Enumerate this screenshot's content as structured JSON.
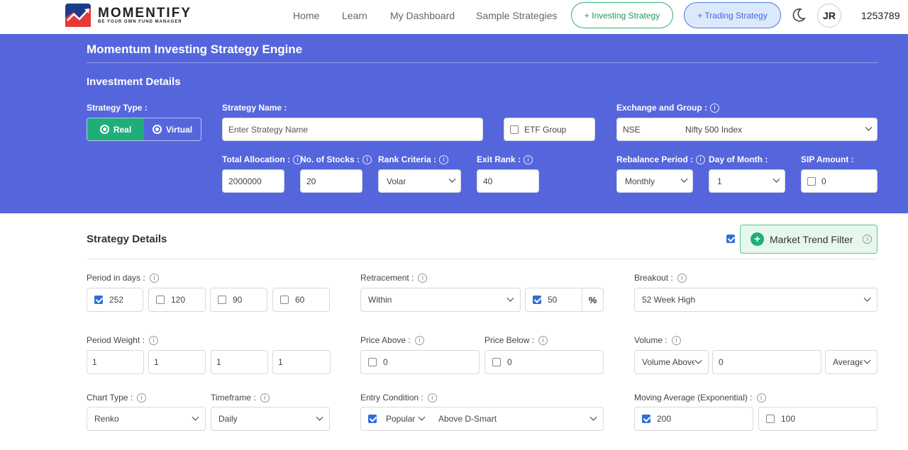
{
  "header": {
    "brand": "MOMENTIFY",
    "tagline": "BE YOUR OWN FUND MANAGER",
    "nav": [
      "Home",
      "Learn",
      "My Dashboard",
      "Sample Strategies"
    ],
    "investing_pill": "+ Investing Strategy",
    "trading_pill": "+ Trading Strategy",
    "avatar": "JR",
    "user_id": "1253789"
  },
  "engine": {
    "title": "Momentum Investing Strategy Engine",
    "subtitle": "Investment Details",
    "strategy_type_label": "Strategy Type :",
    "real_label": "Real",
    "virtual_label": "Virtual",
    "strategy_name_label": "Strategy Name :",
    "strategy_name_placeholder": "Enter Strategy Name",
    "etf_group_label": "ETF Group",
    "exchange_label": "Exchange and Group :",
    "exchange_value": "NSE",
    "group_value": "Nifty 500 Index",
    "total_allocation_label": "Total Allocation :",
    "total_allocation_value": "2000000",
    "num_stocks_label": "No. of Stocks :",
    "num_stocks_value": "20",
    "rank_criteria_label": "Rank Criteria :",
    "rank_criteria_value": "Volar",
    "exit_rank_label": "Exit Rank :",
    "exit_rank_value": "40",
    "rebalance_label": "Rebalance Period :",
    "rebalance_value": "Monthly",
    "day_of_month_label": "Day of Month :",
    "day_of_month_value": "1",
    "sip_label": "SIP Amount :",
    "sip_value": "0"
  },
  "strategy": {
    "title": "Strategy Details",
    "market_trend_filter": "Market Trend Filter",
    "period_label": "Period in days :",
    "periods": [
      "252",
      "120",
      "90",
      "60"
    ],
    "retracement_label": "Retracement :",
    "retracement_mode": "Within",
    "retracement_value": "50",
    "retracement_unit": "%",
    "breakout_label": "Breakout :",
    "breakout_value": "52 Week High",
    "period_weight_label": "Period Weight :",
    "weights": [
      "1",
      "1",
      "1",
      "1"
    ],
    "price_above_label": "Price Above :",
    "price_above_value": "0",
    "price_below_label": "Price Below :",
    "price_below_value": "0",
    "volume_label": "Volume :",
    "volume_mode": "Volume Above",
    "volume_value": "0",
    "volume_agg": "Average",
    "chart_type_label": "Chart Type :",
    "chart_type_value": "Renko",
    "timeframe_label": "Timeframe :",
    "timeframe_value": "Daily",
    "entry_label": "Entry Condition :",
    "entry_category": "Popular",
    "entry_value": "Above D-Smart",
    "ma_label": "Moving Average (Exponential) :",
    "ma_values": [
      "200",
      "100"
    ]
  },
  "colors": {
    "band": "#5566dd",
    "accent_green": "#1fae7a",
    "checkbox_blue": "#2f6fd6"
  }
}
